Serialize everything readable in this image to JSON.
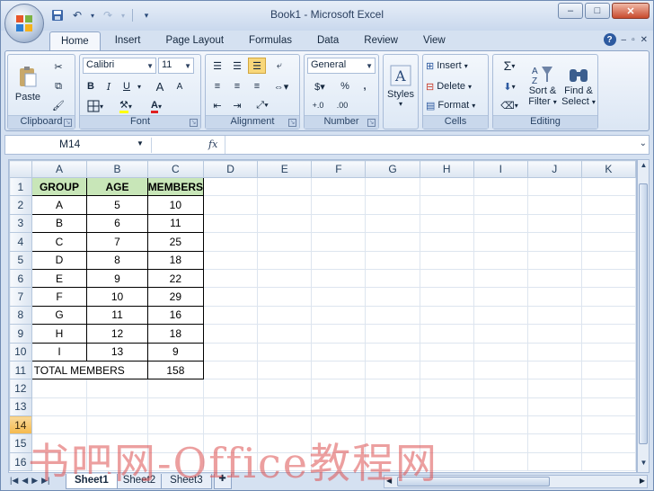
{
  "window": {
    "title": "Book1 - Microsoft Excel",
    "minimize": "–",
    "maximize": "□",
    "close": "✕"
  },
  "qat": {
    "save": "save-icon",
    "undo": "undo-icon",
    "redo": "redo-icon",
    "customize": "▾"
  },
  "tabs": [
    "Home",
    "Insert",
    "Page Layout",
    "Formulas",
    "Data",
    "Review",
    "View"
  ],
  "ribbon": {
    "clipboard": {
      "label": "Clipboard",
      "paste": "Paste"
    },
    "font": {
      "label": "Font",
      "name": "Calibri",
      "size": "11",
      "bold": "B",
      "italic": "I",
      "underline": "U",
      "grow": "A",
      "shrink": "A",
      "fill_glyph": "⚒",
      "color_glyph": "A"
    },
    "alignment": {
      "label": "Alignment"
    },
    "number": {
      "label": "Number",
      "format": "General",
      "percent": "%",
      "comma": ",",
      "inc_decimal": "+.0",
      "dec_decimal": ".00"
    },
    "styles": {
      "label": "Styles"
    },
    "cells": {
      "label": "Cells",
      "insert": "Insert",
      "delete": "Delete",
      "format": "Format"
    },
    "editing": {
      "label": "Editing",
      "sum": "Σ",
      "sort_l1": "Sort &",
      "sort_l2": "Filter",
      "find_l1": "Find &",
      "find_l2": "Select"
    }
  },
  "formula_bar": {
    "name_box": "M14",
    "fx": "fx",
    "value": ""
  },
  "sheet": {
    "columns": [
      "A",
      "B",
      "C",
      "D",
      "E",
      "F",
      "G",
      "H",
      "I",
      "J",
      "K"
    ],
    "rows": [
      "1",
      "2",
      "3",
      "4",
      "5",
      "6",
      "7",
      "8",
      "9",
      "10",
      "11",
      "12",
      "13",
      "14",
      "15",
      "16"
    ],
    "header": [
      "GROUP",
      "AGE",
      "MEMBERS"
    ],
    "data": [
      [
        "A",
        "5",
        "10"
      ],
      [
        "B",
        "6",
        "11"
      ],
      [
        "C",
        "7",
        "25"
      ],
      [
        "D",
        "8",
        "18"
      ],
      [
        "E",
        "9",
        "22"
      ],
      [
        "F",
        "10",
        "29"
      ],
      [
        "G",
        "11",
        "16"
      ],
      [
        "H",
        "12",
        "18"
      ],
      [
        "I",
        "13",
        "9"
      ]
    ],
    "total_label": "TOTAL MEMBERS",
    "total_value": "158",
    "selected_cell": "M14",
    "selected_row": "14"
  },
  "sheet_tabs": [
    "Sheet1",
    "Sheet2",
    "Sheet3"
  ],
  "active_sheet": "Sheet1",
  "watermark": "书吧网-Office教程网",
  "colors": {
    "header_fill": "#c8e6b8",
    "selected_row_header": "#f5b94c"
  }
}
